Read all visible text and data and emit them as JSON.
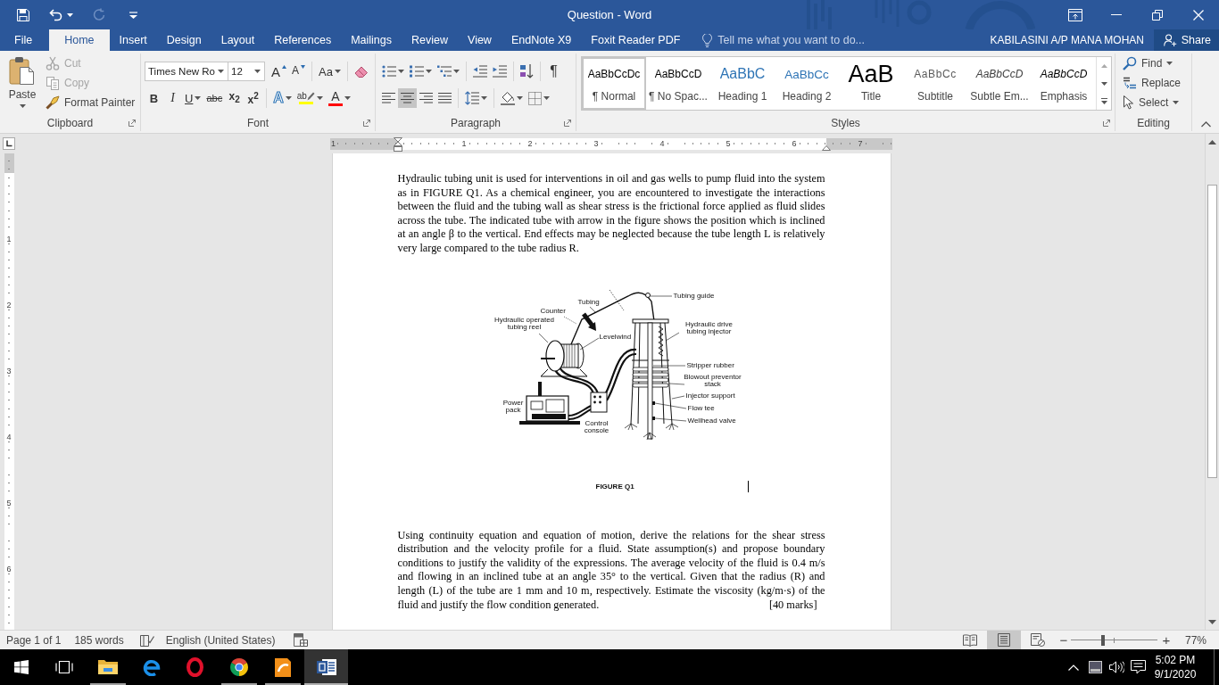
{
  "window": {
    "title": "Question - Word",
    "account": "KABILASINI A/P MANA MOHAN",
    "share": "Share"
  },
  "quick_access": [
    {
      "kind": "save",
      "disabled": false
    },
    {
      "kind": "undo",
      "disabled": false
    },
    {
      "kind": "redo",
      "disabled": true
    },
    {
      "kind": "customize",
      "disabled": false
    }
  ],
  "tabs": [
    {
      "label": "File",
      "selected": false
    },
    {
      "label": "Home",
      "selected": true
    },
    {
      "label": "Insert",
      "selected": false
    },
    {
      "label": "Design",
      "selected": false
    },
    {
      "label": "Layout",
      "selected": false
    },
    {
      "label": "References",
      "selected": false
    },
    {
      "label": "Mailings",
      "selected": false
    },
    {
      "label": "Review",
      "selected": false
    },
    {
      "label": "View",
      "selected": false
    },
    {
      "label": "EndNote X9",
      "selected": false
    },
    {
      "label": "Foxit Reader PDF",
      "selected": false
    }
  ],
  "tell_me": {
    "placeholder": "Tell me what you want to do..."
  },
  "clipboard": {
    "label": "Clipboard",
    "paste": "Paste",
    "commands": [
      {
        "kind": "cut",
        "label": "Cut",
        "disabled": true
      },
      {
        "kind": "copy",
        "label": "Copy",
        "disabled": true
      },
      {
        "kind": "painter",
        "label": "Format Painter",
        "disabled": false
      }
    ]
  },
  "font": {
    "label": "Font",
    "name": "Times New Ro",
    "size": "12",
    "row1": [
      [
        {
          "kind": "grow",
          "label": "A",
          "dropdown": false
        },
        {
          "kind": "shrink",
          "label": "A",
          "dropdown": false
        }
      ],
      [
        {
          "kind": "case",
          "label": "Aa",
          "dropdown": true
        }
      ],
      [
        {
          "kind": "clear",
          "dropdown": false
        }
      ]
    ],
    "row2": [
      [
        {
          "kind": "bold",
          "label": "B",
          "dropdown": false
        },
        {
          "kind": "italic",
          "label": "I",
          "dropdown": false
        },
        {
          "kind": "underline",
          "label": "U",
          "dropdown": true
        },
        {
          "kind": "strike",
          "label": "abc",
          "dropdown": false
        },
        {
          "kind": "sub",
          "label": "x$_{2}$",
          "dropdown": false
        },
        {
          "kind": "sup",
          "label": "x$^{2}$",
          "dropdown": false
        }
      ],
      [
        {
          "kind": "effects",
          "label": "A",
          "dropdown": true
        },
        {
          "kind": "highlight",
          "label": "ab",
          "color": "#ffff00",
          "dropdown": true
        },
        {
          "kind": "fontcolor",
          "label": "A",
          "color": "#ff0000",
          "dropdown": true
        }
      ]
    ]
  },
  "paragraph": {
    "label": "Paragraph",
    "row1": [
      [
        {
          "kind": "bullets",
          "dropdown": true
        },
        {
          "kind": "numbering",
          "dropdown": true
        },
        {
          "kind": "multilevel",
          "dropdown": true
        }
      ],
      [
        {
          "kind": "outdent",
          "dropdown": false
        },
        {
          "kind": "indent",
          "dropdown": false
        }
      ],
      [
        {
          "kind": "sort",
          "dropdown": false
        }
      ],
      [
        {
          "kind": "pilcrow",
          "label": "¶",
          "dropdown": false
        }
      ]
    ],
    "alignment": [
      {
        "kind": "left",
        "selected": false
      },
      {
        "kind": "center",
        "selected": true
      },
      {
        "kind": "right",
        "selected": false
      },
      {
        "kind": "justify",
        "selected": false
      }
    ],
    "row2": [
      [
        {
          "kind": "spacing",
          "dropdown": true
        }
      ],
      [
        {
          "kind": "shading",
          "dropdown": true
        },
        {
          "kind": "borders",
          "dropdown": true
        }
      ]
    ]
  },
  "styles": {
    "label": "Styles",
    "items": [
      {
        "kind": "normal",
        "preview": "AaBbCcDc",
        "name": "¶ Normal",
        "selected": true
      },
      {
        "kind": "nospacing",
        "preview": "AaBbCcD",
        "name": "¶ No Spac...",
        "selected": false
      },
      {
        "kind": "heading1",
        "preview": "AaBbC",
        "name": "Heading 1",
        "selected": false
      },
      {
        "kind": "heading2",
        "preview": "AaBbCc",
        "name": "Heading 2",
        "selected": false
      },
      {
        "kind": "title",
        "preview": "AaB",
        "name": "Title",
        "selected": false
      },
      {
        "kind": "subtitle",
        "preview": "AaBbCc",
        "name": "Subtitle",
        "selected": false
      },
      {
        "kind": "subtle",
        "preview": "AaBbCcD",
        "name": "Subtle Em...",
        "selected": false
      },
      {
        "kind": "emphasis",
        "preview": "AaBbCcD",
        "name": "Emphasis",
        "selected": false
      }
    ]
  },
  "editing": {
    "label": "Editing",
    "commands": [
      {
        "kind": "find",
        "label": "Find",
        "dropdown": true
      },
      {
        "kind": "replace",
        "label": "Replace",
        "dropdown": false
      },
      {
        "kind": "select",
        "label": "Select",
        "dropdown": true
      }
    ]
  },
  "ruler": {
    "horizontal": [
      "1",
      "1",
      "2",
      "3",
      "4",
      "5",
      "6",
      "7"
    ],
    "vertical": [
      "1",
      "2",
      "3",
      "4",
      "5",
      "6"
    ]
  },
  "document": {
    "intro": "Hydraulic tubing unit is used for interventions in oil and gas wells to pump fluid into the system as in FIGURE Q1. As a chemical engineer, you are encountered to investigate the interactions between the fluid and the tubing wall as shear stress is the frictional force applied as fluid slides across the tube. The indicated tube with arrow in the figure shows the position which is inclined at an angle β to the vertical. End effects may be neglected because the tube length L is relatively very large compared to the tube radius R.",
    "figure": {
      "labels": [
        "Tubing guide",
        "Tubing",
        "Counter",
        "Hydraulic operated tubing reel",
        "Hydraulic drive tubing injector",
        "Levelwind",
        "Stripper rubber",
        "Blowout preventor stack",
        "Injector support",
        "Power pack",
        "Flow tee",
        "Wellhead valve",
        "Control console"
      ],
      "caption": "FIGURE Q1"
    },
    "question": "Using continuity equation and equation of motion, derive the relations for the shear stress distribution and the velocity profile for a fluid. State assumption(s) and propose boundary conditions to justify the validity of the expressions. The average velocity of the fluid is 0.4 m/s and flowing in an inclined tube at an angle 35° to the vertical. Given that the radius (R) and length (L) of the tube are 1 mm and 10 m, respectively. Estimate the viscosity (kg/m·s) of the fluid and justify the flow condition generated.",
    "marks": "[40 marks]"
  },
  "status_bar": {
    "page": "Page 1 of 1",
    "words": "185 words",
    "language": "English (United States)",
    "views": [
      {
        "kind": "read",
        "selected": false
      },
      {
        "kind": "print",
        "selected": true
      },
      {
        "kind": "web",
        "selected": false
      }
    ],
    "zoom": {
      "minus": "−",
      "plus": "+",
      "level": 0.37,
      "percent": "77%"
    }
  },
  "taskbar": {
    "apps": [
      {
        "kind": "explorer",
        "running": true,
        "selected": false
      },
      {
        "kind": "edge",
        "running": false,
        "selected": false
      },
      {
        "kind": "opera",
        "running": false,
        "selected": false
      },
      {
        "kind": "chrome",
        "running": true,
        "selected": false
      },
      {
        "kind": "foxit",
        "running": true,
        "selected": false
      },
      {
        "kind": "word",
        "running": true,
        "selected": true
      }
    ],
    "time": "5:02 PM",
    "date": "9/1/2020"
  }
}
